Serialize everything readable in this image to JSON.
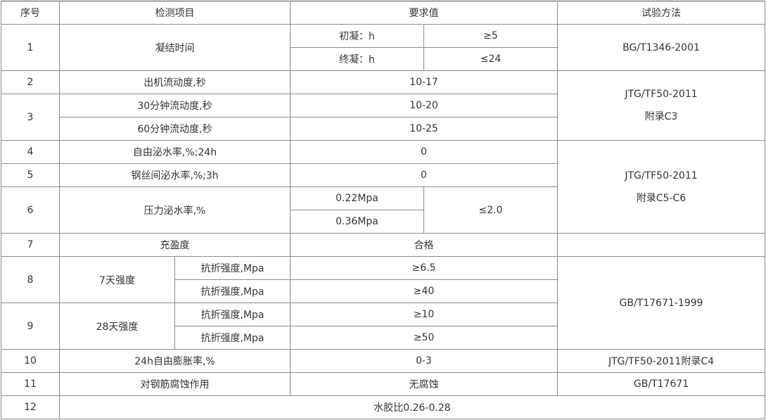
{
  "header": {
    "no": "序号",
    "item": "检测项目",
    "req": "要求值",
    "method": "试验方法"
  },
  "rows": {
    "r1": {
      "no": "1",
      "item": "凝结时间",
      "sub1": "初凝：h",
      "val1": "≥5",
      "sub2": "终凝：h",
      "val2": "≤24",
      "method": "BG/T1346-2001"
    },
    "r2": {
      "no": "2",
      "item": "出机流动度,秒",
      "val": "10-17",
      "method_l1": "JTG/TF50-2011",
      "method_l2": "附录C3"
    },
    "r3": {
      "no": "3",
      "item1": "30分钟流动度,秒",
      "val1": "10-20",
      "item2": "60分钟流动度,秒",
      "val2": "10-25"
    },
    "r4": {
      "no": "4",
      "item": "自由泌水率,%;24h",
      "val": "0",
      "method_l1": "JTG/TF50-2011",
      "method_l2": "附录C5-C6"
    },
    "r5": {
      "no": "5",
      "item": "钢丝间泌水率,%;3h",
      "val": "0"
    },
    "r6": {
      "no": "6",
      "item": "压力泌水率,%",
      "sub1": "0.22Mpa",
      "sub2": "0.36Mpa",
      "val": "≤2.0"
    },
    "r7": {
      "no": "7",
      "item": "充盈度",
      "val": "合格"
    },
    "r8": {
      "no": "8",
      "item": "7天强度",
      "sub1": "抗折强度,Mpa",
      "val1": "≥6.5",
      "sub2": "抗折强度,Mpa",
      "val2": "≥40",
      "method": "GB/T17671-1999"
    },
    "r9": {
      "no": "9",
      "item": "28天强度",
      "sub1": "抗折强度,Mpa",
      "val1": "≥10",
      "sub2": "抗折强度,Mpa",
      "val2": "≥50"
    },
    "r10": {
      "no": "10",
      "item": "24h自由膨胀率,%",
      "val": "0-3",
      "method": "JTG/TF50-2011附录C4"
    },
    "r11": {
      "no": "11",
      "item": "对钢筋腐蚀作用",
      "val": "无腐蚀",
      "method": "GB/T17671"
    },
    "r12": {
      "no": "12",
      "val": "水胶比0.26-0.28"
    }
  }
}
